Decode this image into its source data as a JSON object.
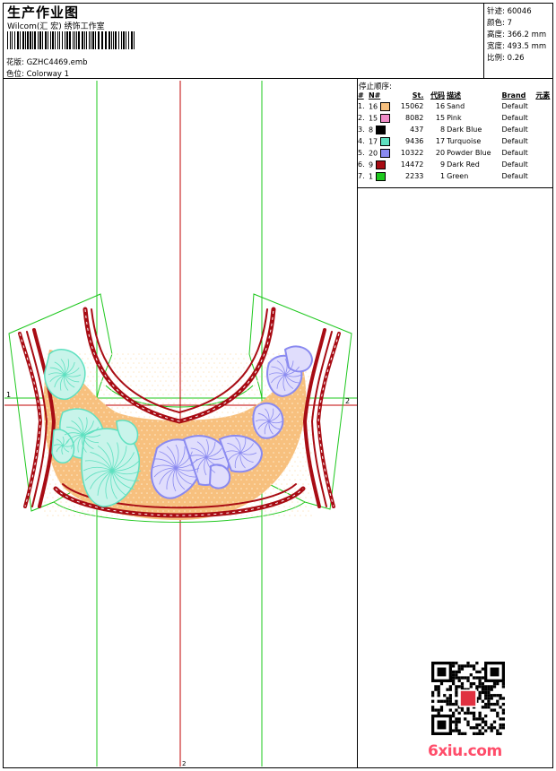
{
  "header": {
    "title": "生产作业图",
    "company": "Wilcom(汇 宏) 绣饰工作室",
    "pattern_label": "花版:",
    "pattern_value": "GZHC4469.emb",
    "colorway_label": "色位:",
    "colorway_value": "Colorway 1"
  },
  "info": [
    {
      "label": "针迹:",
      "value": "60046"
    },
    {
      "label": "颜色:",
      "value": "7"
    },
    {
      "label": "高度:",
      "value": "366.2 mm"
    },
    {
      "label": "宽度:",
      "value": "493.5 mm"
    },
    {
      "label": "比例:",
      "value": "0.26"
    }
  ],
  "sequence": {
    "title": "停止顺序:",
    "headers": [
      "#",
      "N#",
      "St.",
      "代码",
      "描述",
      "Brand",
      "元素"
    ],
    "rows": [
      {
        "idx": "1.",
        "n": "16",
        "color": "#f7c07e",
        "st": "15062",
        "code": "16",
        "desc": "Sand",
        "brand": "Default"
      },
      {
        "idx": "2.",
        "n": "15",
        "color": "#f08cc8",
        "st": "8082",
        "code": "15",
        "desc": "Pink",
        "brand": "Default"
      },
      {
        "idx": "3.",
        "n": "8",
        "color": "#000000",
        "st": "437",
        "code": "8",
        "desc": "Dark Blue",
        "brand": "Default"
      },
      {
        "idx": "4.",
        "n": "17",
        "color": "#5ee0c0",
        "st": "9436",
        "code": "17",
        "desc": "Turquoise",
        "brand": "Default"
      },
      {
        "idx": "5.",
        "n": "20",
        "color": "#8a8af0",
        "st": "10322",
        "code": "20",
        "desc": "Powder Blue",
        "brand": "Default"
      },
      {
        "idx": "6.",
        "n": "9",
        "color": "#a80c14",
        "st": "14472",
        "code": "9",
        "desc": "Dark Red",
        "brand": "Default"
      },
      {
        "idx": "7.",
        "n": "1",
        "color": "#1ec81e",
        "st": "2233",
        "code": "1",
        "desc": "Green",
        "brand": "Default"
      }
    ]
  },
  "design": {
    "marker_left": "1",
    "marker_right": "2",
    "marker_bottom": "2",
    "colors": {
      "sand": "#f7c07e",
      "pink": "#f08cc8",
      "dark_blue": "#000000",
      "turquoise": "#5ee0c0",
      "powder_blue": "#8a8af0",
      "dark_red": "#a80c14",
      "green": "#1ec81e",
      "crosshair": "#c00000"
    }
  },
  "watermark": {
    "text": "6xiu.com"
  }
}
